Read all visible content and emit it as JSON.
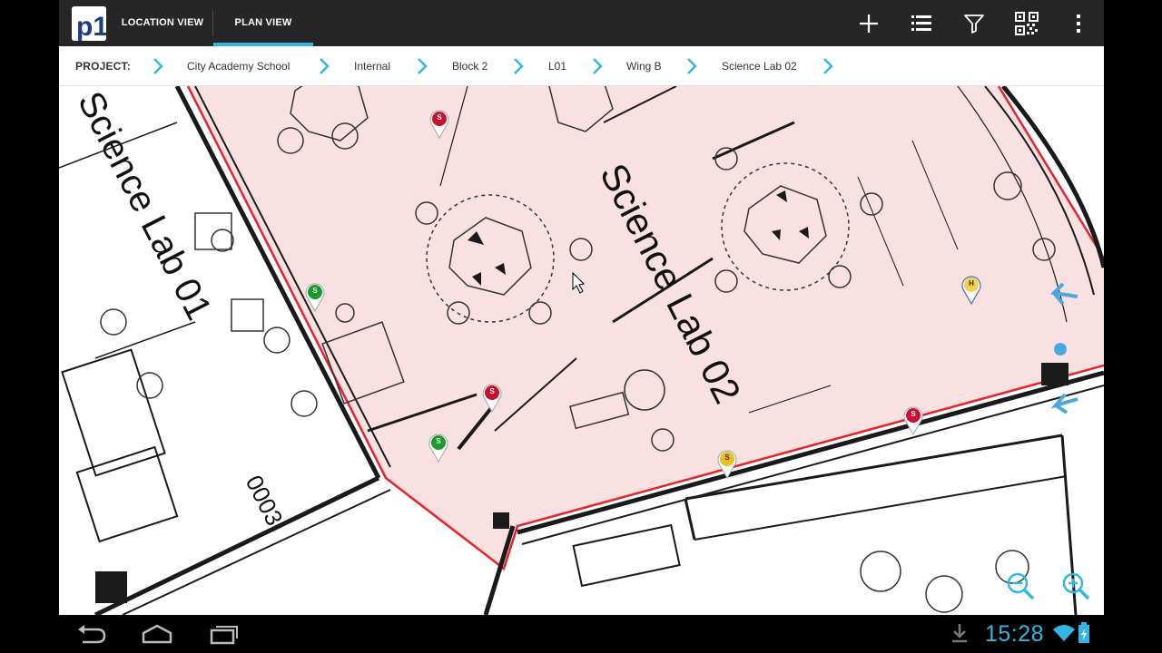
{
  "action_bar": {
    "logo_text": "p1",
    "tabs": [
      {
        "label": "LOCATION VIEW",
        "selected": false
      },
      {
        "label": "PLAN VIEW",
        "selected": true
      }
    ],
    "accent": "#33b5e5",
    "icons": [
      "add-icon",
      "list-icon",
      "filter-icon",
      "qr-code-icon",
      "overflow-menu-icon"
    ]
  },
  "breadcrumb": {
    "label": "PROJECT:",
    "items": [
      "City Academy School",
      "Internal",
      "Block 2",
      "L01",
      "Wing B",
      "Science Lab 02"
    ]
  },
  "plan": {
    "room_labels": [
      "Science Lab 02",
      "Science Lab 01",
      "0003"
    ],
    "highlight_color": "#f9e1e1",
    "outline_color": "#e8222a",
    "pins": [
      {
        "letter": "S",
        "color": "#c8102e"
      },
      {
        "letter": "S",
        "color": "#1a9a2a"
      },
      {
        "letter": "S",
        "color": "#c8102e"
      },
      {
        "letter": "S",
        "color": "#1a9a2a"
      },
      {
        "letter": "S",
        "color": "#e8c020"
      },
      {
        "letter": "S",
        "color": "#c8102e"
      },
      {
        "letter": "H",
        "color": "#f0d050"
      }
    ]
  },
  "zoom": {
    "icons": [
      "zoom-out-icon",
      "zoom-in-icon"
    ]
  },
  "status_bar": {
    "time": "15:28",
    "icons": [
      "back-icon",
      "home-icon",
      "recent-apps-icon",
      "download-icon",
      "wifi-icon",
      "battery-icon"
    ]
  }
}
